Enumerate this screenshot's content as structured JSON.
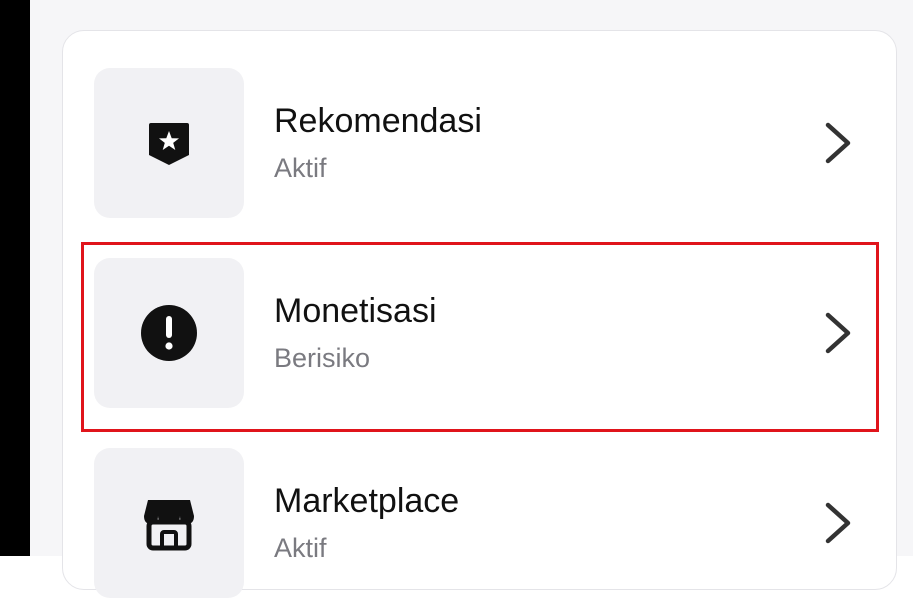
{
  "settings_list": {
    "items": [
      {
        "title": "Rekomendasi",
        "status": "Aktif",
        "icon": "shield-star-icon"
      },
      {
        "title": "Monetisasi",
        "status": "Berisiko",
        "icon": "alert-circle-icon"
      },
      {
        "title": "Marketplace",
        "status": "Aktif",
        "icon": "shop-icon"
      }
    ]
  },
  "highlight": {
    "target": "Monetisasi",
    "color": "#e0141b"
  },
  "colors": {
    "title_text": "#111111",
    "status_text": "#7a7a80",
    "icon_tile": "#f1f1f4",
    "icon": "#111111"
  }
}
